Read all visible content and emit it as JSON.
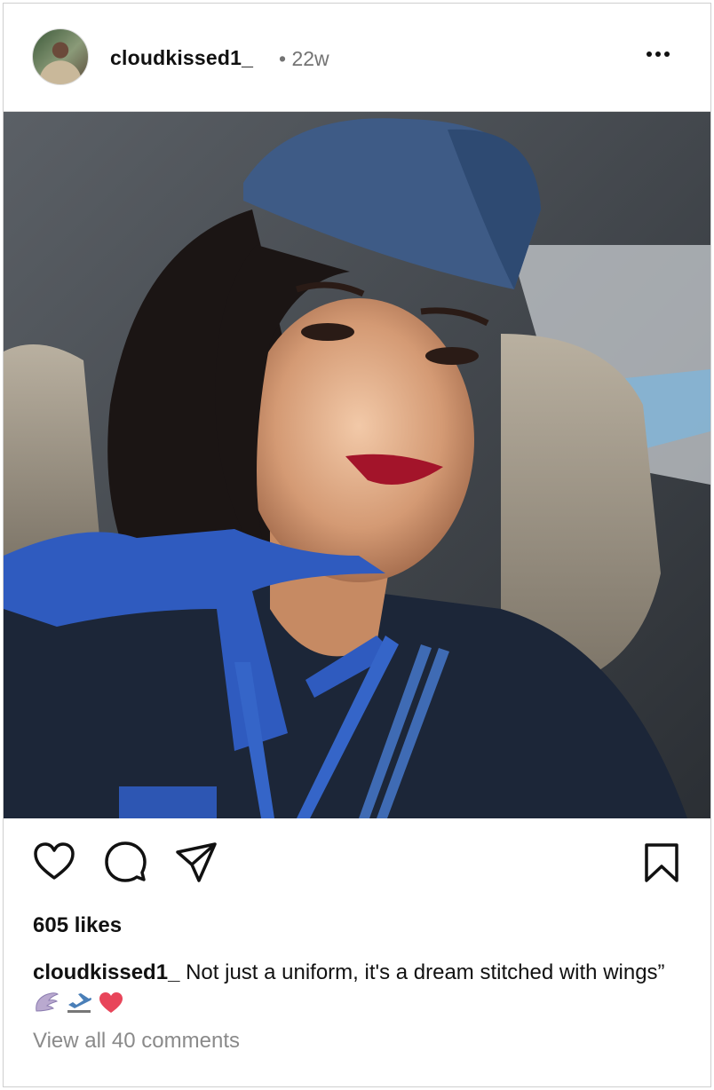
{
  "post": {
    "username": "cloudkissed1_",
    "time": "• 22w",
    "more_icon": "more-horizontal-icon",
    "photo_alt": "Selfie of a flight attendant in a navy uniform, blue hat and blue scarf, sitting in a car",
    "likes": "605 likes",
    "caption_username": "cloudkissed1_",
    "caption_text": " Not just a uniform, it's a dream stitched with wings”",
    "caption_emojis": [
      "wing-icon",
      "airplane-departure-icon",
      "heart-icon"
    ],
    "view_comments": "View all 40 comments"
  },
  "actions": {
    "like_icon": "heart-outline-icon",
    "comment_icon": "comment-bubble-icon",
    "share_icon": "paper-plane-icon",
    "save_icon": "bookmark-icon"
  },
  "colors": {
    "text": "#111111",
    "muted": "#737373",
    "divider": "#dbdbdb",
    "heart": "#e8455a",
    "uniform_blue": "#3f5a8a"
  }
}
